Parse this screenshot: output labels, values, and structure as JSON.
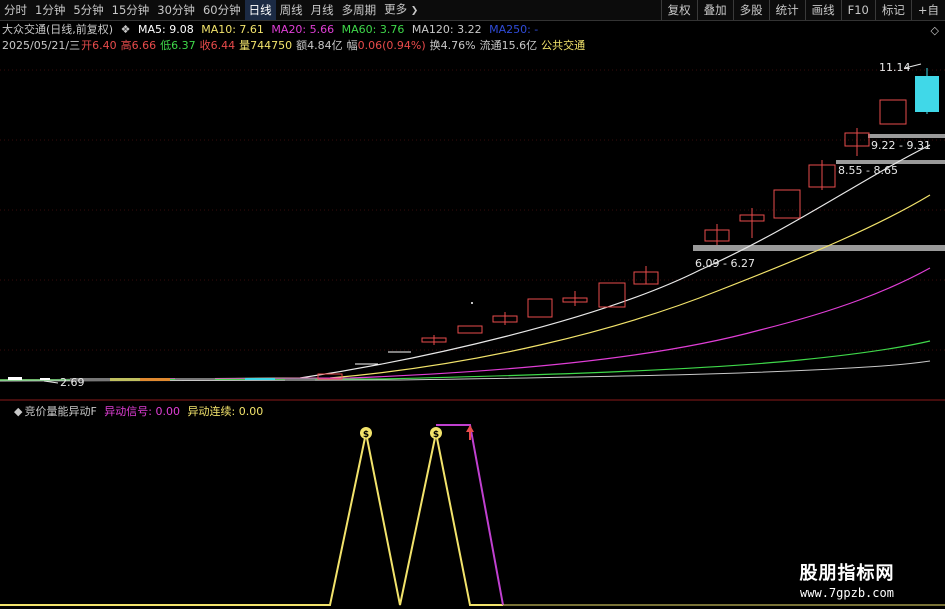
{
  "toolbar": {
    "periods": [
      "分时",
      "1分钟",
      "5分钟",
      "15分钟",
      "30分钟",
      "60分钟",
      "日线",
      "周线",
      "月线",
      "多周期",
      "更多"
    ],
    "active_period": "日线",
    "more_arrow": "❯",
    "actions": [
      "复权",
      "叠加",
      "多股",
      "统计",
      "画线",
      "F10",
      "标记",
      "+自"
    ]
  },
  "stock": {
    "name": "大众交通",
    "mode": "(日线,前复权)",
    "ma_toggle": "❖",
    "ma": [
      {
        "label": "MA5:",
        "value": "9.08",
        "color": "#ffffff"
      },
      {
        "label": "MA10:",
        "value": "7.61",
        "color": "#f2e36b"
      },
      {
        "label": "MA20:",
        "value": "5.66",
        "color": "#e03ed6"
      },
      {
        "label": "MA60:",
        "value": "3.76",
        "color": "#3fd84a"
      },
      {
        "label": "MA120:",
        "value": "3.22",
        "color": "#c8c8c8"
      },
      {
        "label": "MA250:",
        "value": "-",
        "color": "#2f4bd8"
      }
    ],
    "info": {
      "date": "2025/05/21/三",
      "open_label": "开",
      "open": "6.40",
      "high_label": "高",
      "high": "6.66",
      "low_label": "低",
      "low": "6.37",
      "close_label": "收",
      "close": "6.44",
      "vol_label": "量",
      "vol": "744750",
      "amount_label": "额",
      "amount": "4.84亿",
      "change_label": "幅",
      "change": "0.06(0.94%)",
      "turnover_label": "换",
      "turnover": "4.76%",
      "float_label": "流通",
      "float": "15.6亿",
      "tag": "公共交通"
    }
  },
  "labels": {
    "max_price": "11.14",
    "min_price": "2.69",
    "zone_high": "9.22 - 9.31",
    "zone_mid": "8.55 - 8.65",
    "zone_low": "6.09 - 6.27"
  },
  "indicator": {
    "name": "竞价量能异动F",
    "signal_label": "异动信号:",
    "signal_value": "0.00",
    "streak_label": "异动连续:",
    "streak_value": "0.00",
    "colors": {
      "signal": "#e03ed6",
      "line": "#f2e36b",
      "purple": "#c040d0"
    },
    "marker_glyph": "$"
  },
  "watermark": {
    "title": "股朋指标网",
    "url": "www.7gpzb.com"
  },
  "corner_glyph": "◇",
  "colors": {
    "up": "#e84b4b",
    "down": "#40d8e8",
    "flat": "#ffffff"
  }
}
